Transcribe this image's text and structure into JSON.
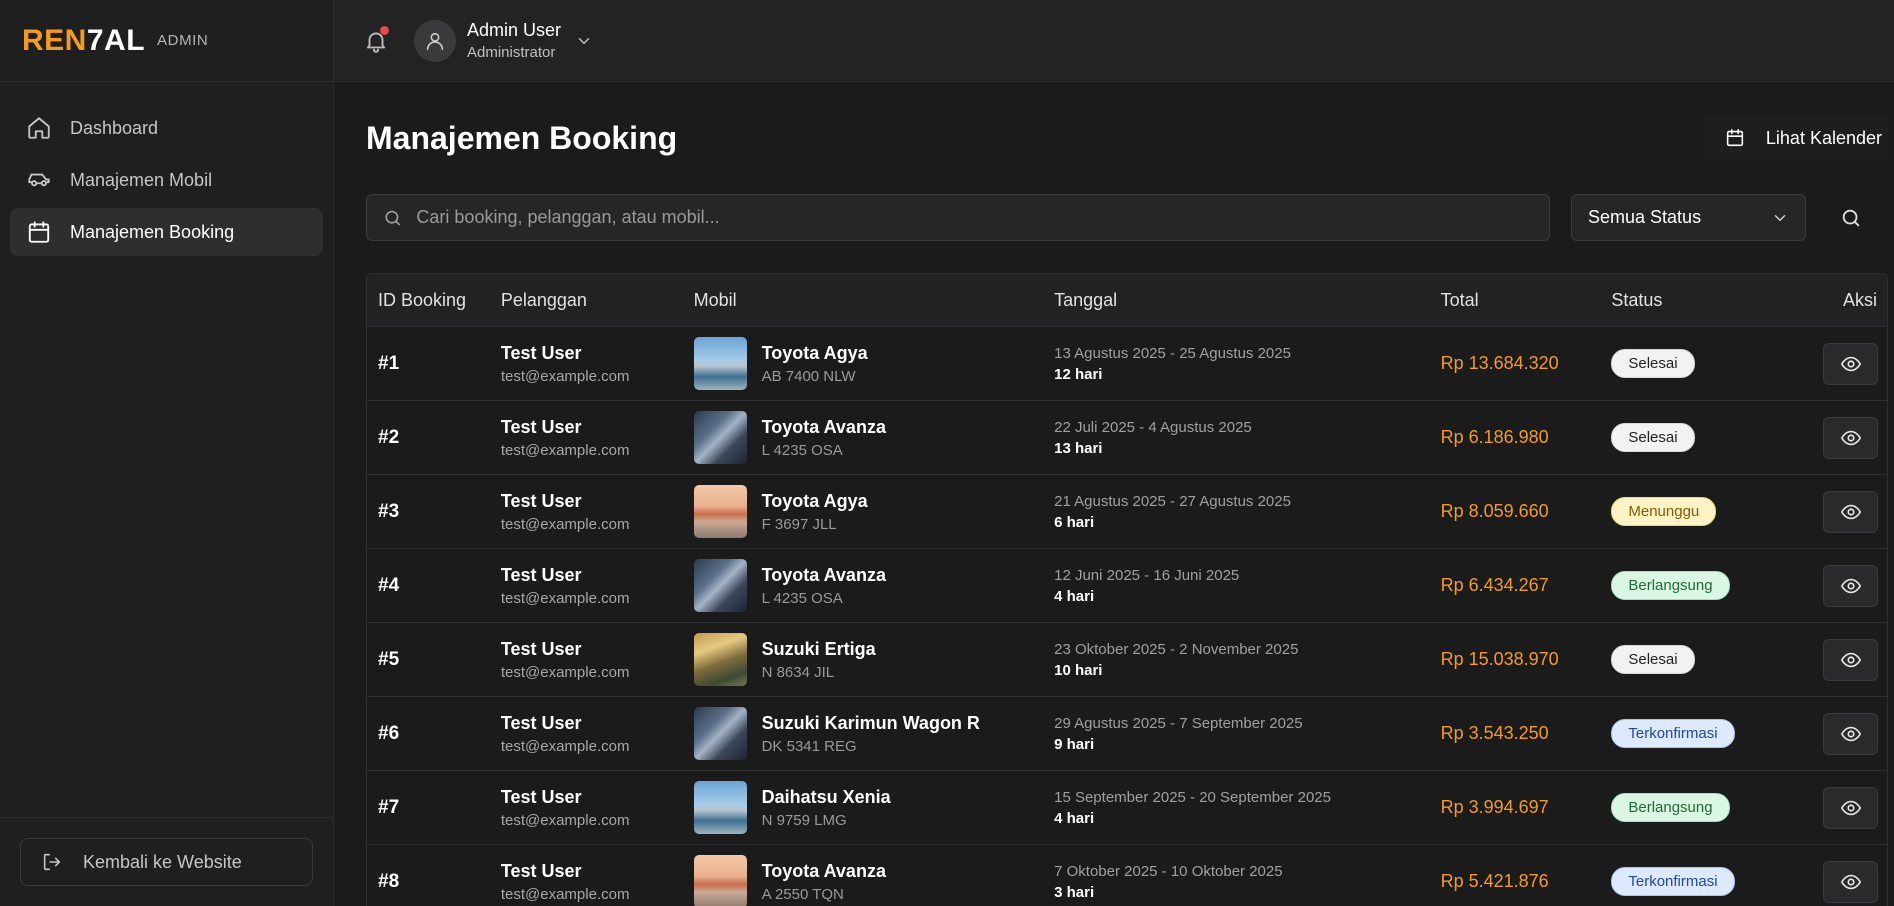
{
  "brand": {
    "logo_part1": "REN",
    "logo_part2": "7AL",
    "tag": "ADMIN"
  },
  "sidebar": {
    "items": [
      {
        "label": "Dashboard",
        "icon": "home-icon",
        "active": false
      },
      {
        "label": "Manajemen Mobil",
        "icon": "car-icon",
        "active": false
      },
      {
        "label": "Manajemen Booking",
        "icon": "calendar-icon",
        "active": true
      }
    ],
    "back_label": "Kembali ke Website"
  },
  "topbar": {
    "notification_dot": true,
    "user_name": "Admin User",
    "user_role": "Administrator"
  },
  "page": {
    "title": "Manajemen Booking",
    "calendar_button": "Lihat Kalender",
    "search_placeholder": "Cari booking, pelanggan, atau mobil...",
    "status_filter": "Semua Status"
  },
  "table": {
    "headers": [
      "ID Booking",
      "Pelanggan",
      "Mobil",
      "Tanggal",
      "Total",
      "Status",
      "Aksi"
    ],
    "rows": [
      {
        "id": "#1",
        "name": "Test User",
        "email": "test@example.com",
        "thumb": "t-sea",
        "car": "Toyota Agya",
        "plate": "AB 7400 NLW",
        "range": "13 Agustus 2025 - 25 Agustus 2025",
        "days": "12 hari",
        "total": "Rp 13.684.320",
        "status": "Selesai",
        "status_class": "b-done"
      },
      {
        "id": "#2",
        "name": "Test User",
        "email": "test@example.com",
        "thumb": "t-hand",
        "car": "Toyota Avanza",
        "plate": "L 4235 OSA",
        "range": "22 Juli 2025 - 4 Agustus 2025",
        "days": "13 hari",
        "total": "Rp 6.186.980",
        "status": "Selesai",
        "status_class": "b-done"
      },
      {
        "id": "#3",
        "name": "Test User",
        "email": "test@example.com",
        "thumb": "t-bridge",
        "car": "Toyota Agya",
        "plate": "F 3697 JLL",
        "range": "21 Agustus 2025 - 27 Agustus 2025",
        "days": "6 hari",
        "total": "Rp 8.059.660",
        "status": "Menunggu",
        "status_class": "b-wait"
      },
      {
        "id": "#4",
        "name": "Test User",
        "email": "test@example.com",
        "thumb": "t-hand",
        "car": "Toyota Avanza",
        "plate": "L 4235 OSA",
        "range": "12 Juni 2025 - 16 Juni 2025",
        "days": "4 hari",
        "total": "Rp 6.434.267",
        "status": "Berlangsung",
        "status_class": "b-run"
      },
      {
        "id": "#5",
        "name": "Test User",
        "email": "test@example.com",
        "thumb": "t-valley",
        "car": "Suzuki Ertiga",
        "plate": "N 8634 JIL",
        "range": "23 Oktober 2025 - 2 November 2025",
        "days": "10 hari",
        "total": "Rp 15.038.970",
        "status": "Selesai",
        "status_class": "b-done"
      },
      {
        "id": "#6",
        "name": "Test User",
        "email": "test@example.com",
        "thumb": "t-hand",
        "car": "Suzuki Karimun Wagon R",
        "plate": "DK 5341 REG",
        "range": "29 Agustus 2025 - 7 September 2025",
        "days": "9 hari",
        "total": "Rp 3.543.250",
        "status": "Terkonfirmasi",
        "status_class": "b-conf"
      },
      {
        "id": "#7",
        "name": "Test User",
        "email": "test@example.com",
        "thumb": "t-sea",
        "car": "Daihatsu Xenia",
        "plate": "N 9759 LMG",
        "range": "15 September 2025 - 20 September 2025",
        "days": "4 hari",
        "total": "Rp 3.994.697",
        "status": "Berlangsung",
        "status_class": "b-run"
      },
      {
        "id": "#8",
        "name": "Test User",
        "email": "test@example.com",
        "thumb": "t-bridge",
        "car": "Toyota Avanza",
        "plate": "A 2550 TQN",
        "range": "7 Oktober 2025 - 10 Oktober 2025",
        "days": "3 hari",
        "total": "Rp 5.421.876",
        "status": "Terkonfirmasi",
        "status_class": "b-conf"
      }
    ]
  },
  "colors": {
    "accent": "#f39c1f",
    "background": "#1b1b1c",
    "sidebar": "#1f1f20"
  }
}
